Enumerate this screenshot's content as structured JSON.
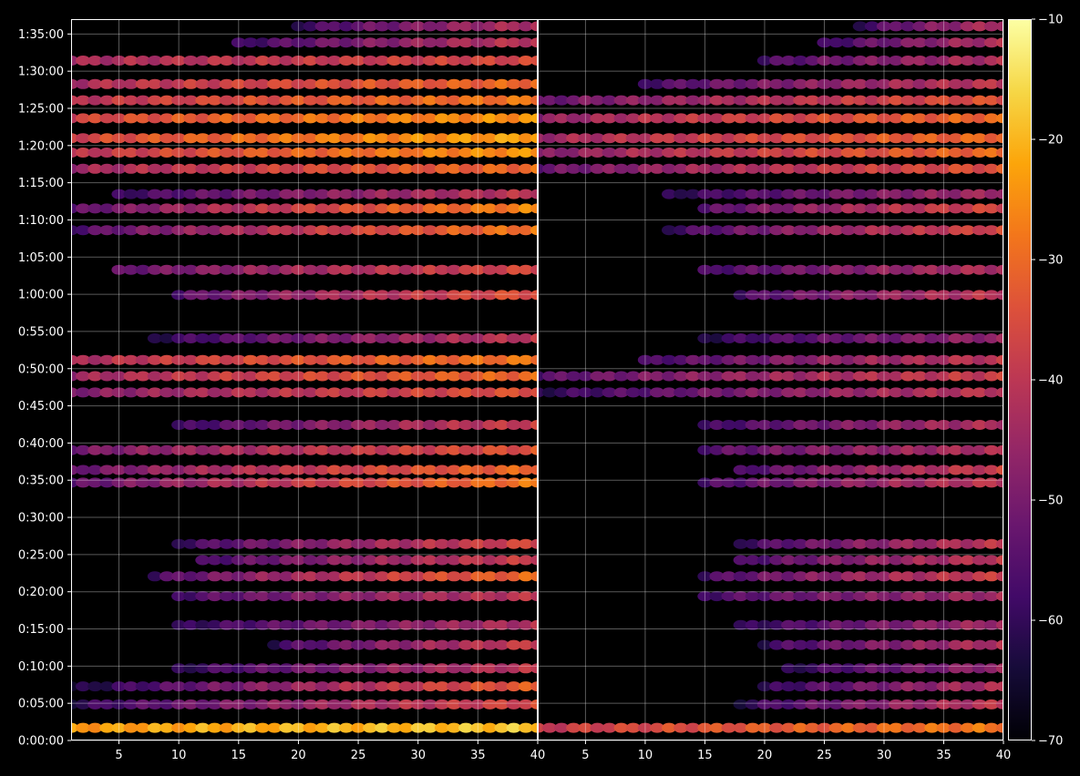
{
  "chart_data": {
    "type": "heatmap",
    "colormap": "inferno",
    "background": "#000000",
    "grid": true,
    "panels": [
      {
        "name": "",
        "xlim": [
          1,
          40
        ],
        "xticks": [
          5,
          10,
          15,
          20,
          25,
          30,
          35,
          40
        ],
        "bands": [
          {
            "t": 0.0175,
            "x0": 1,
            "x1": 40,
            "v0": -24,
            "v1": -18
          },
          {
            "t": 0.05,
            "x0": 1,
            "x1": 40,
            "v0": -62,
            "v1": -36
          },
          {
            "t": 0.075,
            "x0": 1,
            "x1": 40,
            "v0": -66,
            "v1": -32
          },
          {
            "t": 0.1,
            "x0": 10,
            "x1": 40,
            "v0": -62,
            "v1": -40
          },
          {
            "t": 0.1325,
            "x0": 18,
            "x1": 40,
            "v0": -60,
            "v1": -38
          },
          {
            "t": 0.16,
            "x0": 10,
            "x1": 40,
            "v0": -62,
            "v1": -42
          },
          {
            "t": 0.2,
            "x0": 10,
            "x1": 40,
            "v0": -58,
            "v1": -40
          },
          {
            "t": 0.2275,
            "x0": 8,
            "x1": 40,
            "v0": -58,
            "v1": -30
          },
          {
            "t": 0.25,
            "x0": 12,
            "x1": 40,
            "v0": -58,
            "v1": -38
          },
          {
            "t": 0.2725,
            "x0": 10,
            "x1": 40,
            "v0": -60,
            "v1": -36
          },
          {
            "t": 0.3575,
            "x0": 1,
            "x1": 40,
            "v0": -56,
            "v1": -28
          },
          {
            "t": 0.375,
            "x0": 1,
            "x1": 40,
            "v0": -54,
            "v1": -30
          },
          {
            "t": 0.4025,
            "x0": 1,
            "x1": 40,
            "v0": -52,
            "v1": -34
          },
          {
            "t": 0.4375,
            "x0": 10,
            "x1": 40,
            "v0": -60,
            "v1": -38
          },
          {
            "t": 0.4825,
            "x0": 1,
            "x1": 40,
            "v0": -50,
            "v1": -34
          },
          {
            "t": 0.505,
            "x0": 1,
            "x1": 40,
            "v0": -46,
            "v1": -30
          },
          {
            "t": 0.5275,
            "x0": 1,
            "x1": 40,
            "v0": -44,
            "v1": -28
          },
          {
            "t": 0.5575,
            "x0": 8,
            "x1": 40,
            "v0": -62,
            "v1": -40
          },
          {
            "t": 0.6175,
            "x0": 10,
            "x1": 40,
            "v0": -56,
            "v1": -34
          },
          {
            "t": 0.6525,
            "x0": 5,
            "x1": 40,
            "v0": -54,
            "v1": -36
          },
          {
            "t": 0.7075,
            "x0": 1,
            "x1": 40,
            "v0": -58,
            "v1": -28
          },
          {
            "t": 0.7375,
            "x0": 1,
            "x1": 40,
            "v0": -56,
            "v1": -26
          },
          {
            "t": 0.7575,
            "x0": 5,
            "x1": 40,
            "v0": -60,
            "v1": -40
          },
          {
            "t": 0.7925,
            "x0": 1,
            "x1": 40,
            "v0": -46,
            "v1": -30
          },
          {
            "t": 0.815,
            "x0": 1,
            "x1": 40,
            "v0": -42,
            "v1": -24
          },
          {
            "t": 0.835,
            "x0": 1,
            "x1": 40,
            "v0": -38,
            "v1": -22
          },
          {
            "t": 0.8625,
            "x0": 1,
            "x1": 40,
            "v0": -38,
            "v1": -24
          },
          {
            "t": 0.8875,
            "x0": 1,
            "x1": 40,
            "v0": -42,
            "v1": -28
          },
          {
            "t": 0.91,
            "x0": 1,
            "x1": 40,
            "v0": -44,
            "v1": -30
          },
          {
            "t": 0.9425,
            "x0": 1,
            "x1": 40,
            "v0": -44,
            "v1": -36
          },
          {
            "t": 0.9675,
            "x0": 15,
            "x1": 40,
            "v0": -60,
            "v1": -40
          },
          {
            "t": 0.99,
            "x0": 20,
            "x1": 40,
            "v0": -60,
            "v1": -42
          }
        ]
      },
      {
        "name": "",
        "xlim": [
          1,
          40
        ],
        "xticks": [
          5,
          10,
          15,
          20,
          25,
          30,
          35,
          40
        ],
        "bands": [
          {
            "t": 0.0175,
            "x0": 1,
            "x1": 40,
            "v0": -40,
            "v1": -28
          },
          {
            "t": 0.05,
            "x0": 18,
            "x1": 40,
            "v0": -62,
            "v1": -40
          },
          {
            "t": 0.075,
            "x0": 20,
            "x1": 40,
            "v0": -62,
            "v1": -42
          },
          {
            "t": 0.1,
            "x0": 22,
            "x1": 40,
            "v0": -62,
            "v1": -46
          },
          {
            "t": 0.1325,
            "x0": 20,
            "x1": 40,
            "v0": -60,
            "v1": -42
          },
          {
            "t": 0.16,
            "x0": 18,
            "x1": 40,
            "v0": -62,
            "v1": -44
          },
          {
            "t": 0.2,
            "x0": 15,
            "x1": 40,
            "v0": -58,
            "v1": -44
          },
          {
            "t": 0.2275,
            "x0": 15,
            "x1": 40,
            "v0": -58,
            "v1": -38
          },
          {
            "t": 0.25,
            "x0": 18,
            "x1": 40,
            "v0": -58,
            "v1": -40
          },
          {
            "t": 0.2725,
            "x0": 18,
            "x1": 40,
            "v0": -60,
            "v1": -40
          },
          {
            "t": 0.3575,
            "x0": 15,
            "x1": 40,
            "v0": -58,
            "v1": -40
          },
          {
            "t": 0.375,
            "x0": 18,
            "x1": 40,
            "v0": -58,
            "v1": -38
          },
          {
            "t": 0.4025,
            "x0": 15,
            "x1": 40,
            "v0": -56,
            "v1": -42
          },
          {
            "t": 0.4375,
            "x0": 15,
            "x1": 40,
            "v0": -60,
            "v1": -42
          },
          {
            "t": 0.4825,
            "x0": 1,
            "x1": 40,
            "v0": -62,
            "v1": -40
          },
          {
            "t": 0.505,
            "x0": 1,
            "x1": 40,
            "v0": -56,
            "v1": -38
          },
          {
            "t": 0.5275,
            "x0": 10,
            "x1": 40,
            "v0": -58,
            "v1": -40
          },
          {
            "t": 0.5575,
            "x0": 15,
            "x1": 40,
            "v0": -62,
            "v1": -46
          },
          {
            "t": 0.6175,
            "x0": 18,
            "x1": 40,
            "v0": -58,
            "v1": -40
          },
          {
            "t": 0.6525,
            "x0": 15,
            "x1": 40,
            "v0": -58,
            "v1": -42
          },
          {
            "t": 0.7075,
            "x0": 12,
            "x1": 40,
            "v0": -60,
            "v1": -36
          },
          {
            "t": 0.7375,
            "x0": 15,
            "x1": 40,
            "v0": -56,
            "v1": -36
          },
          {
            "t": 0.7575,
            "x0": 12,
            "x1": 40,
            "v0": -62,
            "v1": -44
          },
          {
            "t": 0.7925,
            "x0": 1,
            "x1": 40,
            "v0": -54,
            "v1": -34
          },
          {
            "t": 0.815,
            "x0": 1,
            "x1": 40,
            "v0": -50,
            "v1": -30
          },
          {
            "t": 0.835,
            "x0": 1,
            "x1": 40,
            "v0": -46,
            "v1": -30
          },
          {
            "t": 0.8625,
            "x0": 1,
            "x1": 40,
            "v0": -48,
            "v1": -30
          },
          {
            "t": 0.8875,
            "x0": 1,
            "x1": 40,
            "v0": -54,
            "v1": -34
          },
          {
            "t": 0.91,
            "x0": 10,
            "x1": 40,
            "v0": -58,
            "v1": -40
          },
          {
            "t": 0.9425,
            "x0": 20,
            "x1": 40,
            "v0": -58,
            "v1": -42
          },
          {
            "t": 0.9675,
            "x0": 25,
            "x1": 40,
            "v0": -60,
            "v1": -42
          },
          {
            "t": 0.99,
            "x0": 28,
            "x1": 40,
            "v0": -60,
            "v1": -42
          }
        ]
      }
    ],
    "ytick_labels": [
      "0:00:00",
      "0:05:00",
      "0:10:00",
      "0:15:00",
      "0:20:00",
      "0:25:00",
      "0:30:00",
      "0:35:00",
      "0:40:00",
      "0:45:00",
      "0:50:00",
      "0:55:00",
      "1:00:00",
      "1:05:00",
      "1:10:00",
      "1:15:00",
      "1:20:00",
      "1:25:00",
      "1:30:00",
      "1:35:00"
    ],
    "ytick_seconds": [
      0,
      300,
      600,
      900,
      1200,
      1500,
      1800,
      2100,
      2400,
      2700,
      3000,
      3300,
      3600,
      3900,
      4200,
      4500,
      4800,
      5100,
      5400,
      5700
    ],
    "y_range_seconds": [
      0,
      5820
    ],
    "colorbar": {
      "vmin": -70,
      "vmax": -10,
      "ticks": [
        -70,
        -60,
        -50,
        -40,
        -30,
        -20,
        -10
      ],
      "tick_labels": [
        "−70",
        "−60",
        "−50",
        "−40",
        "−30",
        "−20",
        "−10"
      ]
    }
  }
}
